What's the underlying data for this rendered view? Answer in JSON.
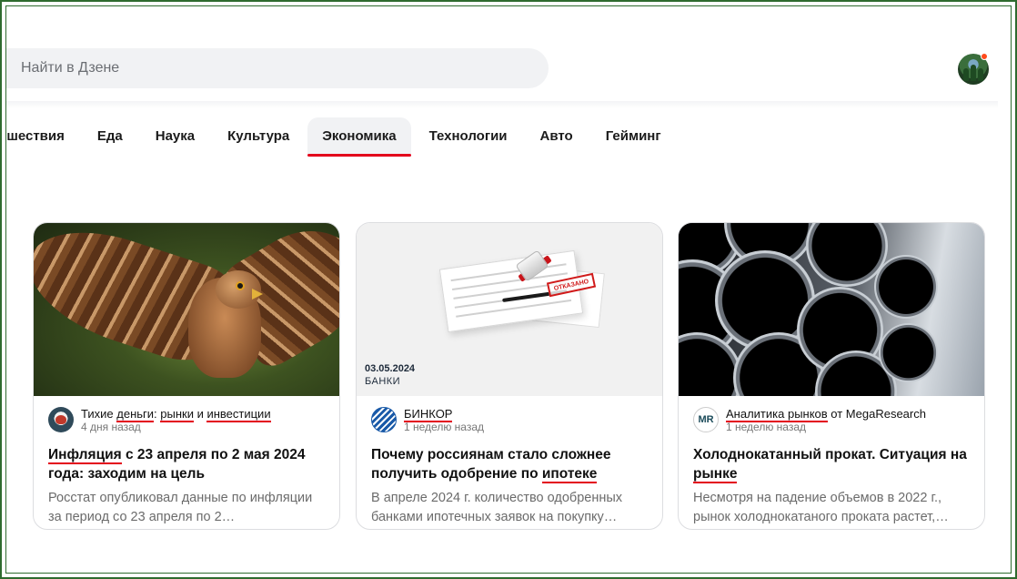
{
  "search": {
    "placeholder": "Найти в Дзене"
  },
  "tabs": [
    {
      "label": "ешествия",
      "active": false
    },
    {
      "label": "Еда",
      "active": false
    },
    {
      "label": "Наука",
      "active": false
    },
    {
      "label": "Культура",
      "active": false
    },
    {
      "label": "Экономика",
      "active": true
    },
    {
      "label": "Технологии",
      "active": false
    },
    {
      "label": "Авто",
      "active": false
    },
    {
      "label": "Гейминг",
      "active": false
    }
  ],
  "cards": [
    {
      "source_parts": [
        "Тихие ",
        "деньги",
        ": ",
        "рынки",
        " и ",
        "инвестиции"
      ],
      "time": "4 дня назад",
      "title_u": "Инфляция",
      "title_rest": " с 23 апреля по 2 мая 2024 года: заходим на цель",
      "desc": "Росстат опубликовал данные по инфляции за период со 23 апреля по 2…"
    },
    {
      "source_name": "БИНКОР",
      "time": "1 неделю назад",
      "image_date": "03.05.2024",
      "image_tag": "БАНКИ",
      "stamp_text": "ОТКАЗАНО",
      "title_pre": "Почему россиянам стало сложнее получить одобрение по ",
      "title_u": "ипотеке",
      "desc": "В апреле 2024 г. количество одобренных банками ипотечных заявок на покупку…"
    },
    {
      "source_u": "Аналитика рынков",
      "source_rest": " от MegaResearch",
      "logo_text": "MR",
      "time": "1 неделю назад",
      "title_pre": "Холоднокатанный прокат. Ситуация на ",
      "title_u": "рынке",
      "desc": "Несмотря на падение объемов в 2022 г., рынок холоднокатаного проката растет,…"
    }
  ],
  "colors": {
    "accent": "#e3001b",
    "frame": "#2f6b2f",
    "notification": "#ff4a1c"
  }
}
